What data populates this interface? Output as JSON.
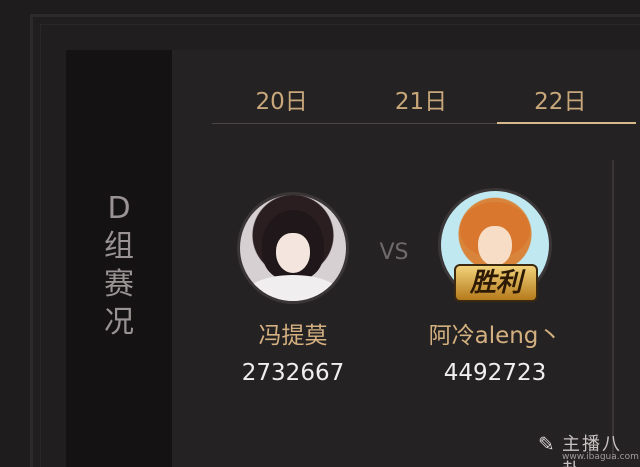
{
  "side_label": "D组赛况",
  "tabs": [
    {
      "label": "20日",
      "active": false
    },
    {
      "label": "21日",
      "active": false
    },
    {
      "label": "22日",
      "active": true
    }
  ],
  "match": {
    "player1": {
      "name": "冯提莫",
      "score": "2732667"
    },
    "vs_label": "VS",
    "player2": {
      "name": "阿冷aleng丶",
      "score": "4492723",
      "badge": "胜利"
    }
  },
  "watermark": {
    "title": "主播八卦",
    "url": "www.ibagua.com"
  },
  "colors": {
    "accent": "#d8b98c",
    "name": "#d4b081",
    "background": "#252223"
  }
}
